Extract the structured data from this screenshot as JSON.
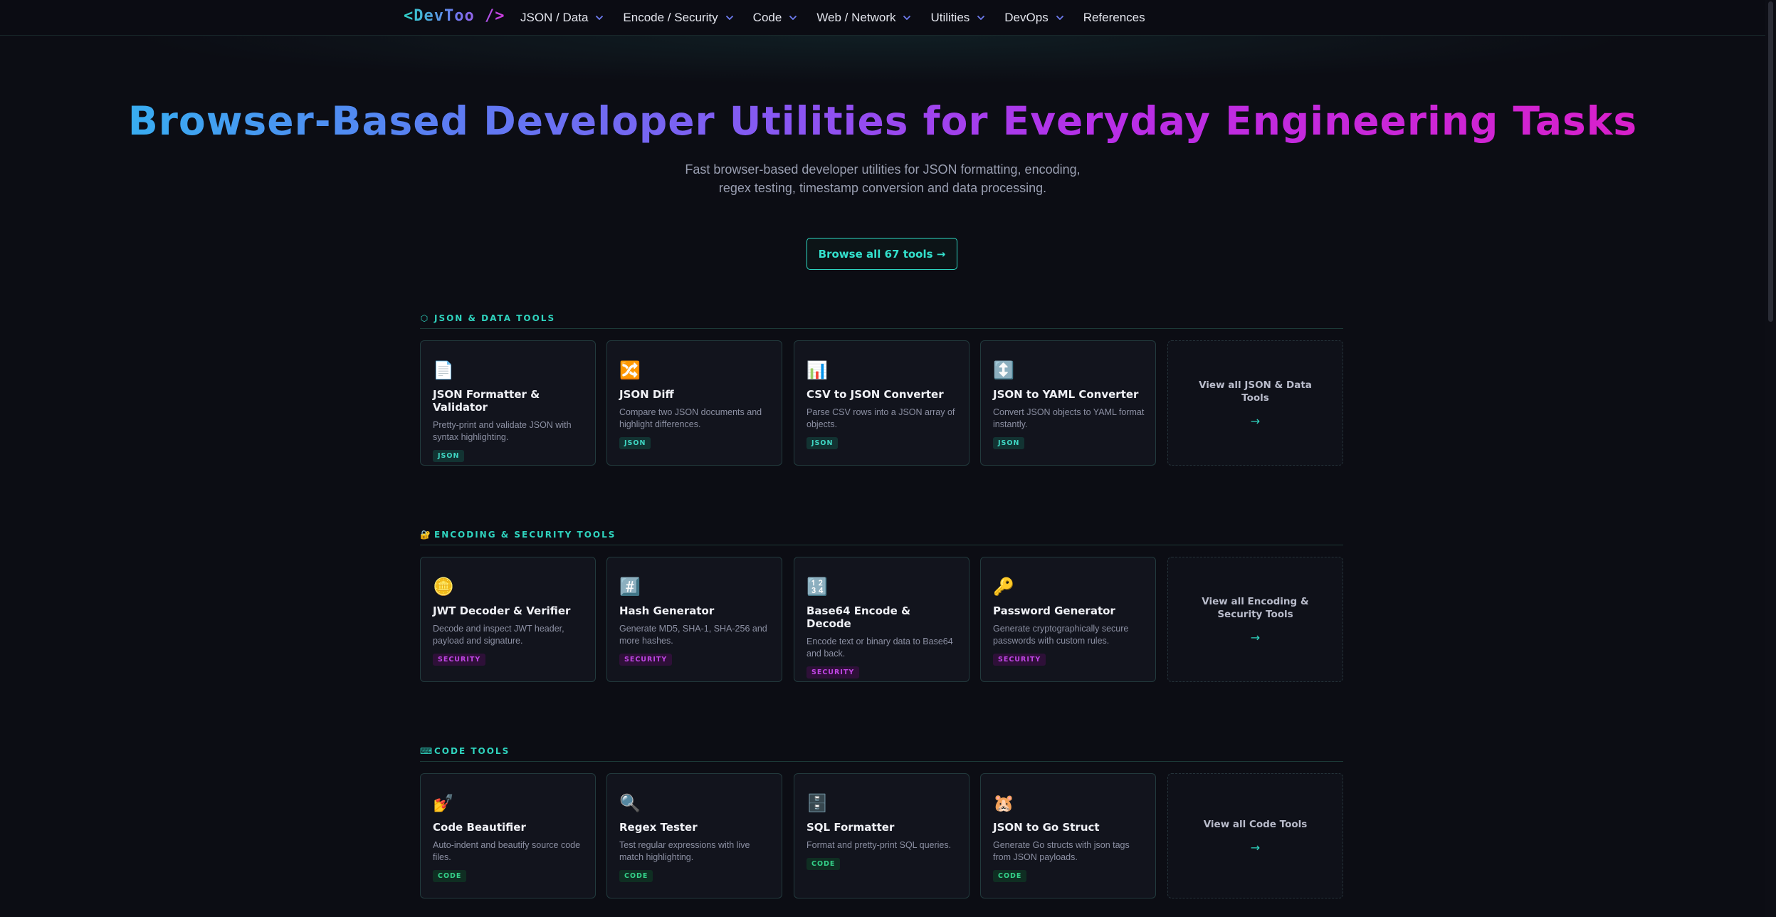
{
  "nav": {
    "logo": "<DevToo />",
    "items": [
      {
        "label": "JSON / Data",
        "dropdown": true
      },
      {
        "label": "Encode / Security",
        "dropdown": true
      },
      {
        "label": "Code",
        "dropdown": true
      },
      {
        "label": "Web / Network",
        "dropdown": true
      },
      {
        "label": "Utilities",
        "dropdown": true
      },
      {
        "label": "DevOps",
        "dropdown": true
      },
      {
        "label": "References",
        "dropdown": false
      }
    ]
  },
  "hero": {
    "title": "Browser-Based Developer Utilities for Everyday Engineering Tasks",
    "subtitle": "Fast browser-based developer utilities for JSON formatting, encoding, regex testing, timestamp conversion and data processing.",
    "cta": "Browse all 67 tools →"
  },
  "colors": {
    "accent": "#2dd4bf",
    "background": "#0c0d14",
    "card": "#12141d",
    "security_tag": "#c246e6",
    "code_tag": "#34d38a"
  },
  "sections": [
    {
      "icon": "⬡",
      "icon_name": "hexagon-icon",
      "title": "JSON & DATA TOOLS",
      "tools": [
        {
          "icon": "📄",
          "icon_name": "document-icon",
          "title": "JSON Formatter & Validator",
          "desc": "Pretty-print and validate JSON with syntax highlighting.",
          "tag": "JSON"
        },
        {
          "icon": "🔀",
          "icon_name": "shuffle-icon",
          "title": "JSON Diff",
          "desc": "Compare two JSON documents and highlight differences.",
          "tag": "JSON"
        },
        {
          "icon": "📊",
          "icon_name": "bar-chart-icon",
          "title": "CSV to JSON Converter",
          "desc": "Parse CSV rows into a JSON array of objects.",
          "tag": "JSON"
        },
        {
          "icon": "↕️",
          "icon_name": "up-down-arrow-icon",
          "title": "JSON to YAML Converter",
          "desc": "Convert JSON objects to YAML format instantly.",
          "tag": "JSON"
        }
      ],
      "view_all": "View all JSON & Data Tools",
      "arrow": "→"
    },
    {
      "icon": "🔐",
      "icon_name": "lock-key-icon",
      "title": "ENCODING & SECURITY TOOLS",
      "tools": [
        {
          "icon": "🪙",
          "icon_name": "coin-icon",
          "title": "JWT Decoder & Verifier",
          "desc": "Decode and inspect JWT header, payload and signature.",
          "tag": "SECURITY"
        },
        {
          "icon": "#️⃣",
          "icon_name": "hash-icon",
          "title": "Hash Generator",
          "desc": "Generate MD5, SHA-1, SHA-256 and more hashes.",
          "tag": "SECURITY"
        },
        {
          "icon": "🔢",
          "icon_name": "numbers-icon",
          "title": "Base64 Encode & Decode",
          "desc": "Encode text or binary data to Base64 and back.",
          "tag": "SECURITY"
        },
        {
          "icon": "🔑",
          "icon_name": "key-icon",
          "title": "Password Generator",
          "desc": "Generate cryptographically secure passwords with custom rules.",
          "tag": "SECURITY"
        }
      ],
      "view_all": "View all Encoding & Security Tools",
      "arrow": "→"
    },
    {
      "icon": "⌨",
      "icon_name": "keyboard-icon",
      "title": "CODE TOOLS",
      "tools": [
        {
          "icon": "💅",
          "icon_name": "nail-polish-icon",
          "title": "Code Beautifier",
          "desc": "Auto-indent and beautify source code files.",
          "tag": "CODE"
        },
        {
          "icon": "🔍",
          "icon_name": "magnifier-icon",
          "title": "Regex Tester",
          "desc": "Test regular expressions with live match highlighting.",
          "tag": "CODE"
        },
        {
          "icon": "🗄️",
          "icon_name": "file-cabinet-icon",
          "title": "SQL Formatter",
          "desc": "Format and pretty-print SQL queries.",
          "tag": "CODE"
        },
        {
          "icon": "🐹",
          "icon_name": "gopher-icon",
          "title": "JSON to Go Struct",
          "desc": "Generate Go structs with json tags from JSON payloads.",
          "tag": "CODE"
        }
      ],
      "view_all": "View all Code Tools",
      "arrow": "→"
    }
  ]
}
